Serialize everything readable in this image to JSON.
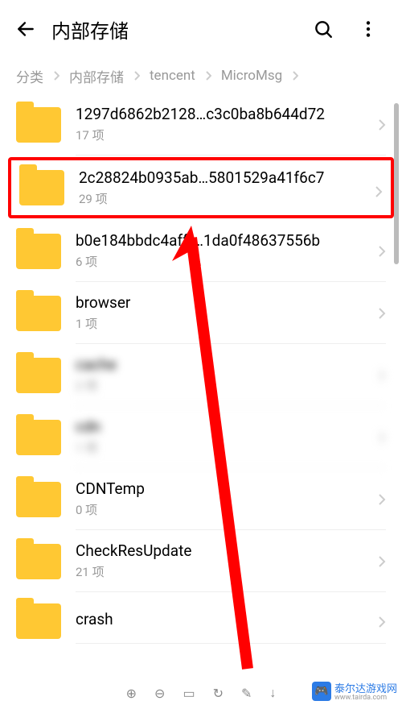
{
  "header": {
    "title": "内部存储"
  },
  "breadcrumb": {
    "items": [
      "分类",
      "内部存储",
      "tencent",
      "MicroMsg"
    ]
  },
  "folders": [
    {
      "name": "1297d6862b2128…c3c0ba8b644d72",
      "meta": "17 项",
      "highlighted": false,
      "blurred": false
    },
    {
      "name": "2c28824b0935ab…5801529a41f6c7",
      "meta": "29 项",
      "highlighted": true,
      "blurred": false
    },
    {
      "name": "b0e184bbdc4afff…1da0f48637556b",
      "meta": "6 项",
      "highlighted": false,
      "blurred": false
    },
    {
      "name": "browser",
      "meta": "1 项",
      "highlighted": false,
      "blurred": false
    },
    {
      "name": "cache",
      "meta": "2 项",
      "highlighted": false,
      "blurred": true
    },
    {
      "name": "cdn",
      "meta": "1 项",
      "highlighted": false,
      "blurred": true
    },
    {
      "name": "CDNTemp",
      "meta": "0 项",
      "highlighted": false,
      "blurred": false
    },
    {
      "name": "CheckResUpdate",
      "meta": "21 项",
      "highlighted": false,
      "blurred": false
    },
    {
      "name": "crash",
      "meta": "",
      "highlighted": false,
      "blurred": false
    }
  ],
  "watermark": {
    "brand": "泰尔达游戏网",
    "url": "www.tairda.com"
  }
}
